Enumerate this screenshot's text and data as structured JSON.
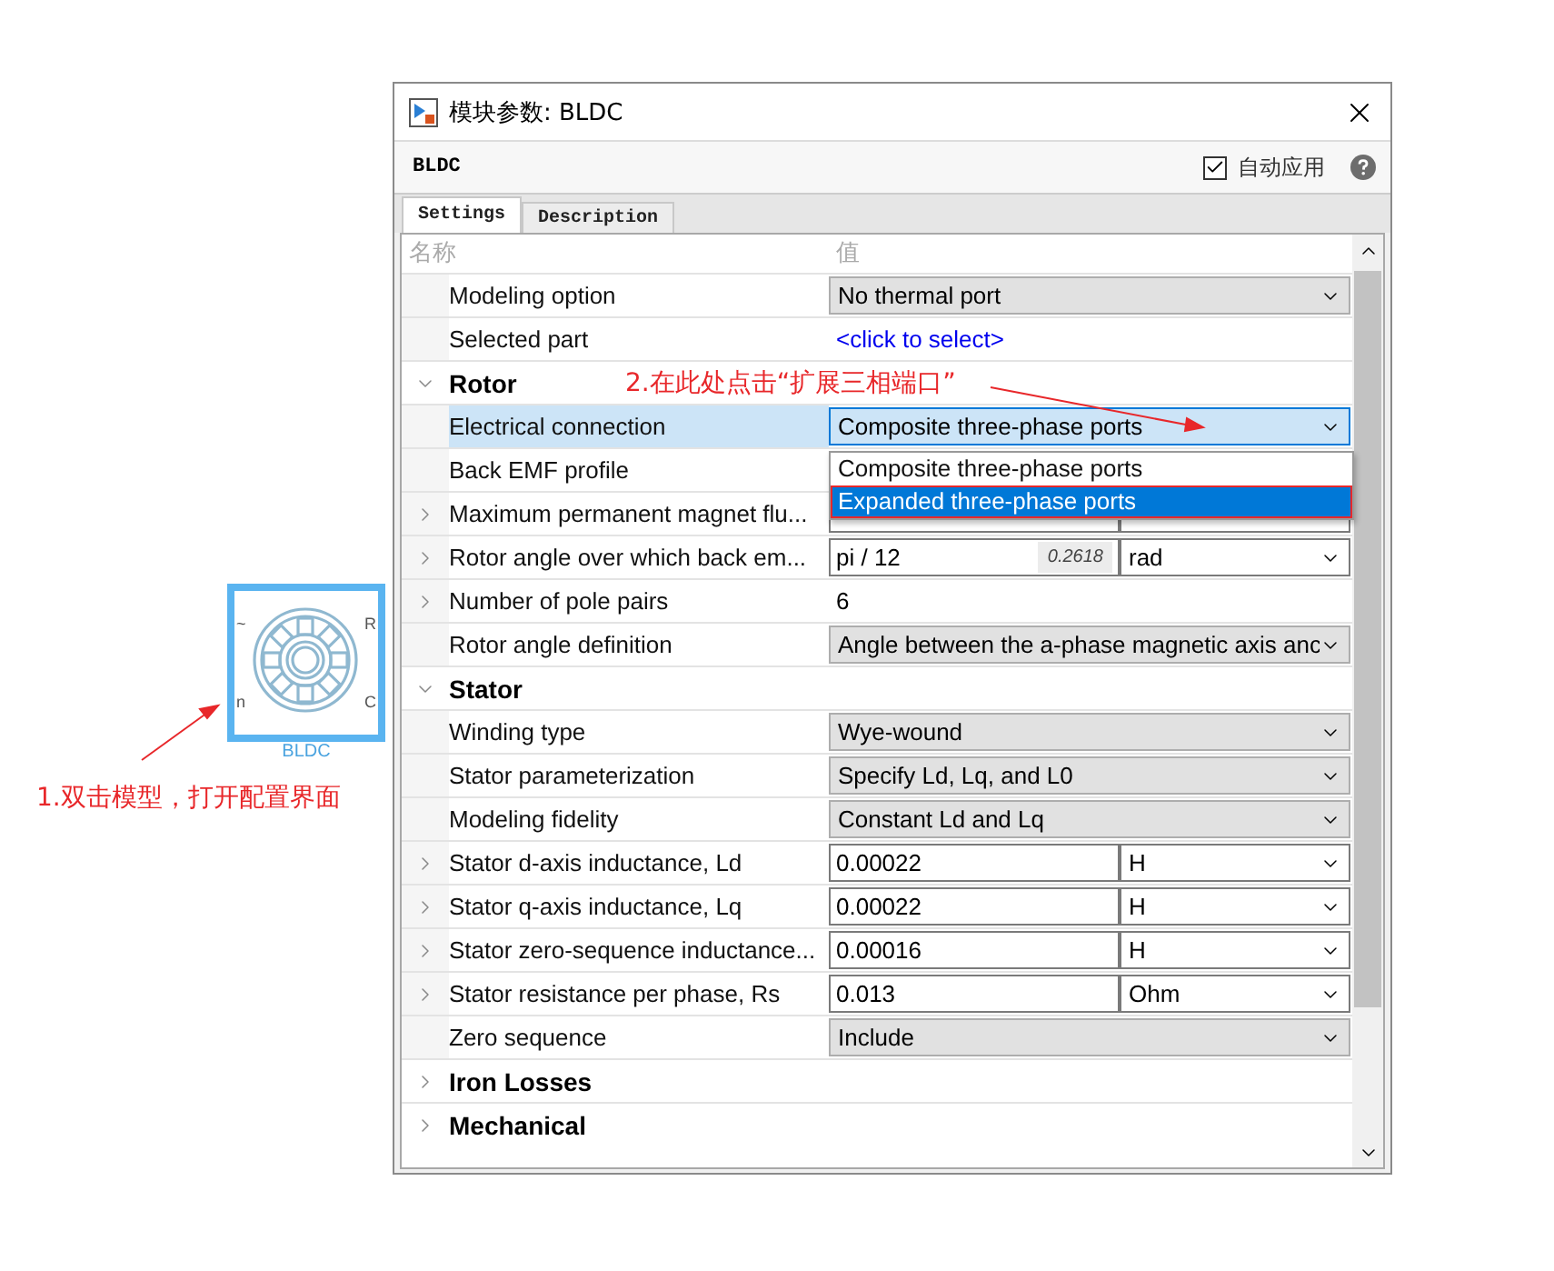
{
  "block": {
    "caption": "BLDC",
    "ports": [
      "~",
      "n",
      "R",
      "C"
    ]
  },
  "annotations": [
    {
      "text": "2.在此处点击“扩展三相端口”"
    },
    {
      "text": "1.双击模型，打开配置界面"
    }
  ],
  "window": {
    "title": "模块参数: BLDC",
    "block_name": "BLDC",
    "auto_apply": {
      "label": "自动应用",
      "checked": true
    }
  },
  "tabs": [
    {
      "label": "Settings",
      "selected": true
    },
    {
      "label": "Description",
      "selected": false
    }
  ],
  "table": {
    "columns": [
      "名称",
      "值"
    ],
    "rows": [
      {
        "kind": "dropdown",
        "name": "Modeling option",
        "value": "No thermal port",
        "selected": false
      },
      {
        "kind": "link",
        "name": "Selected part",
        "value": "<click to select>",
        "selected": false
      },
      {
        "kind": "section",
        "name": "Rotor",
        "expanded": true
      },
      {
        "kind": "dropdown",
        "name": "Electrical connection",
        "value": "Composite three-phase ports",
        "selected": true
      },
      {
        "kind": "hidden",
        "name": "Back EMF profile",
        "selected": false
      },
      {
        "kind": "covered",
        "name": "Maximum permanent magnet flu...",
        "expanded": false,
        "selected": false
      },
      {
        "kind": "expression",
        "name": "Rotor angle over which back em...",
        "value": "pi / 12",
        "evaluated": "0.2618",
        "unit": "rad",
        "expanded": false,
        "selected": false
      },
      {
        "kind": "text",
        "name": "Number of pole pairs",
        "value": "6",
        "expanded": false,
        "selected": false
      },
      {
        "kind": "dropdown",
        "name": "Rotor angle definition",
        "value": "Angle between the a-phase magnetic axis anc",
        "selected": false
      },
      {
        "kind": "section",
        "name": "Stator",
        "expanded": true
      },
      {
        "kind": "dropdown",
        "name": "Winding type",
        "value": "Wye-wound",
        "selected": false
      },
      {
        "kind": "dropdown",
        "name": "Stator parameterization",
        "value": "Specify Ld, Lq, and L0",
        "selected": false
      },
      {
        "kind": "dropdown",
        "name": "Modeling fidelity",
        "value": "Constant Ld and Lq",
        "selected": false
      },
      {
        "kind": "value-unit",
        "name": "Stator d-axis inductance, Ld",
        "value": "0.00022",
        "unit": "H",
        "expanded": false,
        "selected": false
      },
      {
        "kind": "value-unit",
        "name": "Stator q-axis inductance, Lq",
        "value": "0.00022",
        "unit": "H",
        "expanded": false,
        "selected": false
      },
      {
        "kind": "value-unit",
        "name": "Stator zero-sequence inductance...",
        "value": "0.00016",
        "unit": "H",
        "expanded": false,
        "selected": false
      },
      {
        "kind": "value-unit",
        "name": "Stator resistance per phase, Rs",
        "value": "0.013",
        "unit": "Ohm",
        "expanded": false,
        "selected": false
      },
      {
        "kind": "dropdown",
        "name": "Zero sequence",
        "value": "Include",
        "selected": false
      },
      {
        "kind": "section",
        "name": "Iron Losses",
        "expanded": false
      },
      {
        "kind": "section",
        "name": "Mechanical",
        "expanded": false
      }
    ]
  },
  "dropdown_menu": {
    "options": [
      {
        "label": "Composite three-phase ports",
        "selected": false,
        "marked": false
      },
      {
        "label": "Expanded three-phase ports",
        "selected": true,
        "marked": true
      }
    ]
  }
}
